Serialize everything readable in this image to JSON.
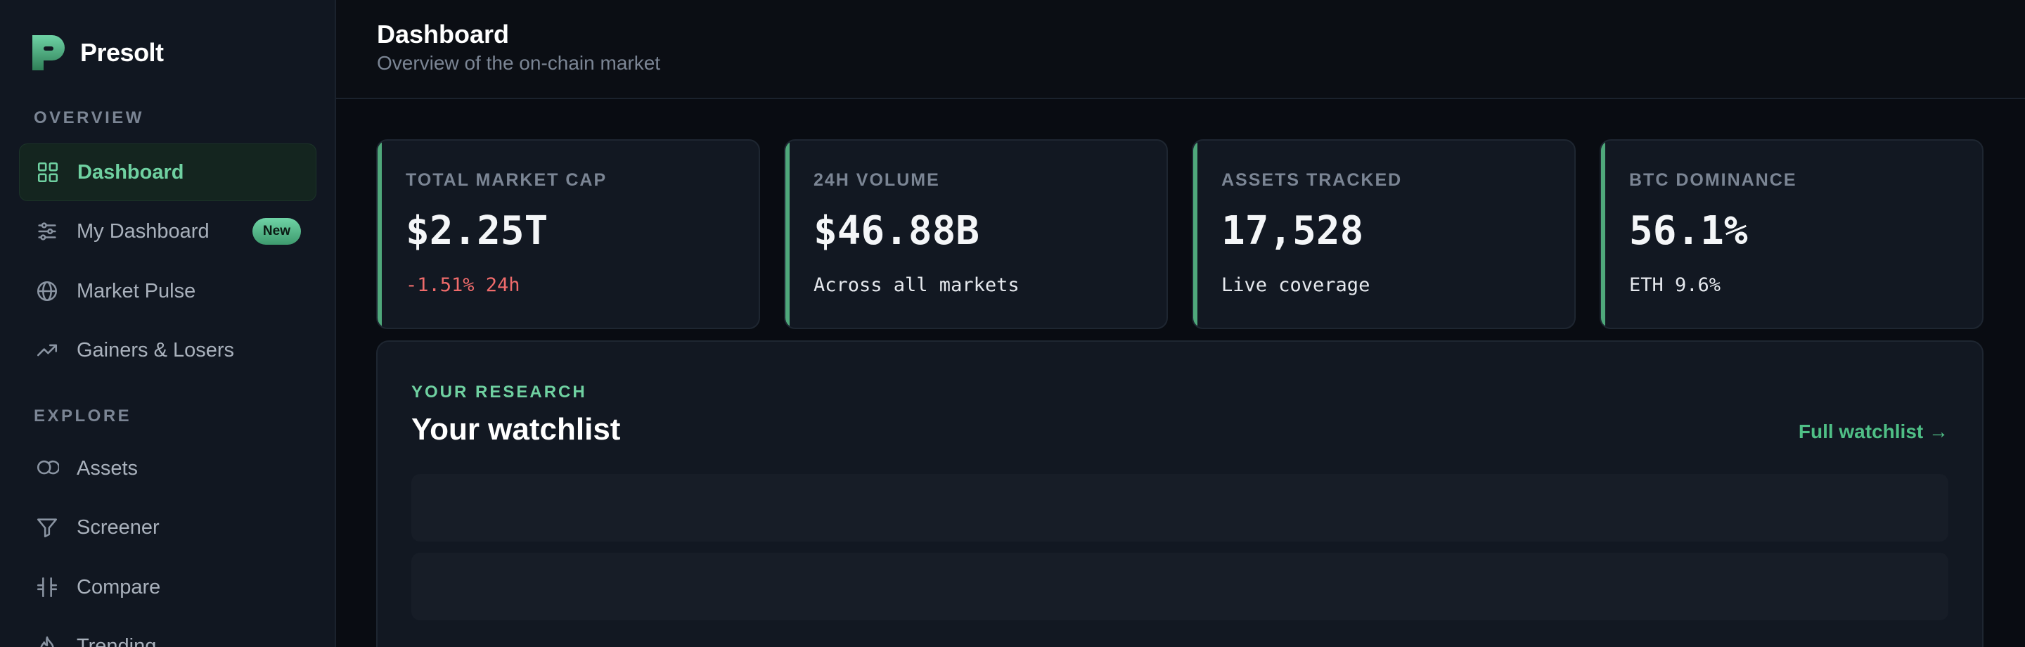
{
  "brand": {
    "name": "Presolt"
  },
  "sidebar": {
    "sections": [
      {
        "label": "OVERVIEW",
        "items": [
          {
            "label": "Dashboard",
            "icon": "grid-icon",
            "active": true
          },
          {
            "label": "My Dashboard",
            "icon": "sliders-icon",
            "badge": "New"
          },
          {
            "label": "Market Pulse",
            "icon": "globe-icon"
          },
          {
            "label": "Gainers & Losers",
            "icon": "trending-up-icon"
          }
        ]
      },
      {
        "label": "EXPLORE",
        "items": [
          {
            "label": "Assets",
            "icon": "coins-icon"
          },
          {
            "label": "Screener",
            "icon": "filter-icon"
          },
          {
            "label": "Compare",
            "icon": "compare-icon"
          },
          {
            "label": "Trending",
            "icon": "flame-icon"
          }
        ]
      }
    ]
  },
  "header": {
    "title": "Dashboard",
    "subtitle": "Overview of the on-chain market"
  },
  "stats": [
    {
      "label": "TOTAL MARKET CAP",
      "value": "$2.25T",
      "sub": "-1.51% 24h",
      "sub_tone": "negative"
    },
    {
      "label": "24H VOLUME",
      "value": "$46.88B",
      "sub": "Across all markets"
    },
    {
      "label": "ASSETS TRACKED",
      "value": "17,528",
      "sub": "Live coverage"
    },
    {
      "label": "BTC DOMINANCE",
      "value": "56.1%",
      "sub": "ETH 9.6%"
    }
  ],
  "watchlist": {
    "eyebrow": "YOUR RESEARCH",
    "title": "Your watchlist",
    "link": "Full watchlist →"
  },
  "colors": {
    "accent": "#6fd1a1",
    "negative": "#ef6b6b",
    "background": "#090c12",
    "sidebar": "#111721",
    "card": "#121822"
  }
}
